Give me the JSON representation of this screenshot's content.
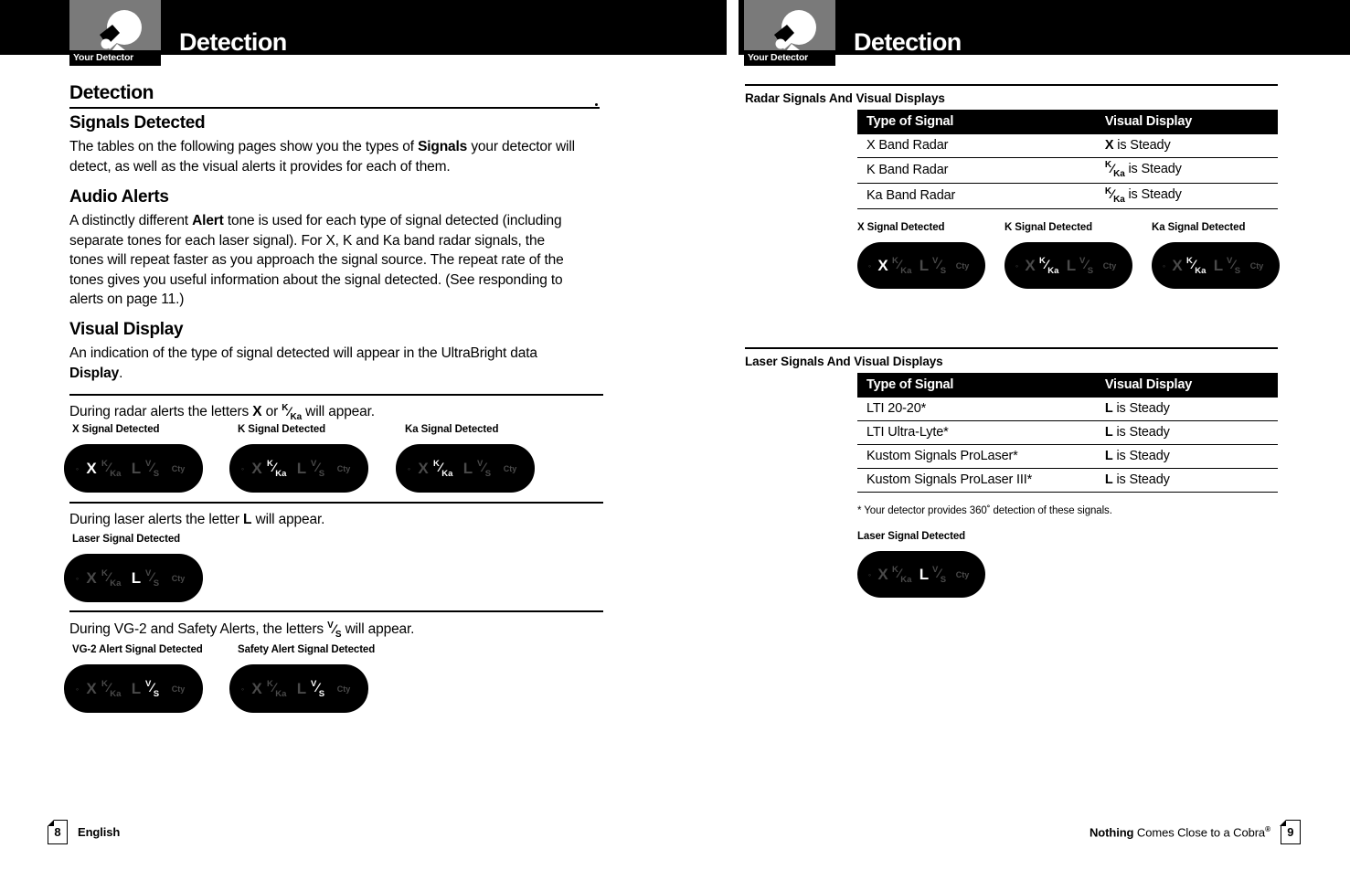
{
  "document": {
    "header_title": "Detection",
    "tab_label": "Your Detector",
    "tab_icon": "radar-detector-icon"
  },
  "left_page": {
    "section_title": "Detection",
    "signals_detected": {
      "heading": "Signals Detected",
      "paragraph_pre": "The tables on the following pages show you the types of ",
      "paragraph_bold": "Signals",
      "paragraph_post": " your detector will detect, as well as the visual alerts it provides for each of them."
    },
    "audio_alerts": {
      "heading": "Audio Alerts",
      "paragraph_pre": "A distinctly different ",
      "paragraph_bold": "Alert",
      "paragraph_post": " tone is used for each type of signal detected (including separate tones for each laser signal). For X, K and Ka band radar signals, the tones will repeat faster as you approach the signal source. The repeat rate of the tones gives you useful information about the signal detected. (See responding to alerts on page 11.)"
    },
    "visual_display": {
      "heading": "Visual Display",
      "paragraph_pre": "An indication of the type of signal detected will appear in the UltraBright data ",
      "paragraph_bold": "Display",
      "paragraph_post": "."
    },
    "radar_line": {
      "pre": "During radar alerts the letters ",
      "bold1": "X",
      "mid": " or ",
      "glyph": "K/Ka",
      "post": " will appear."
    },
    "laser_line": {
      "pre": "During laser alerts the letter ",
      "bold1": "L",
      "post": " will appear."
    },
    "vg2_line": {
      "pre": "During VG-2 and Safety Alerts, the letters ",
      "glyph": "V/S",
      "post": " will appear."
    },
    "radar_displays": [
      {
        "caption": "X Signal Detected",
        "active": "X"
      },
      {
        "caption": "K Signal Detected",
        "active": "KKa"
      },
      {
        "caption": "Ka Signal Detected",
        "active": "KKa"
      }
    ],
    "laser_displays": [
      {
        "caption": "Laser Signal Detected",
        "active": "L"
      }
    ],
    "vg2_displays": [
      {
        "caption": "VG-2 Alert Signal Detected",
        "active": "VS"
      },
      {
        "caption": "Safety Alert Signal Detected",
        "active": "VS"
      }
    ],
    "footer": {
      "page_number": "8",
      "label": "English"
    }
  },
  "right_page": {
    "radar_section": {
      "heading": "Radar Signals And Visual Displays",
      "columns": [
        "Type of Signal",
        "Visual Display"
      ],
      "rows": [
        {
          "signal": "X Band Radar",
          "display_symbol": "X",
          "display_text": " is Steady"
        },
        {
          "signal": "K Band Radar",
          "display_symbol": "K/Ka",
          "display_text": " is Steady"
        },
        {
          "signal": "Ka Band Radar",
          "display_symbol": "K/Ka",
          "display_text": " is Steady"
        }
      ],
      "displays": [
        {
          "caption": "X Signal Detected",
          "active": "X"
        },
        {
          "caption": "K Signal Detected",
          "active": "KKa"
        },
        {
          "caption": "Ka Signal Detected",
          "active": "KKa"
        }
      ]
    },
    "laser_section": {
      "heading": "Laser Signals And Visual Displays",
      "columns": [
        "Type of Signal",
        "Visual Display"
      ],
      "rows": [
        {
          "signal": "LTI 20-20*",
          "display_symbol": "L",
          "display_text": " is Steady"
        },
        {
          "signal": "LTI Ultra-Lyte*",
          "display_symbol": "L",
          "display_text": " is Steady"
        },
        {
          "signal": "Kustom Signals ProLaser*",
          "display_symbol": "L",
          "display_text": " is Steady"
        },
        {
          "signal": "Kustom Signals ProLaser III*",
          "display_symbol": "L",
          "display_text": " is Steady"
        }
      ],
      "note": "* Your detector provides 360˚ detection of these signals.",
      "displays": [
        {
          "caption": "Laser Signal Detected",
          "active": "L"
        }
      ]
    },
    "footer": {
      "page_number": "9",
      "tagline_bold": "Nothing",
      "tagline_rest": " Comes Close to a Cobra",
      "registered": "®"
    }
  },
  "display_segments": {
    "speaker": "speaker-icon",
    "x": "X",
    "k_num": "K",
    "k_slash": "/",
    "k_den": "Ka",
    "l": "L",
    "v_num": "V",
    "v_slash": "/",
    "v_den": "S",
    "cty": "Cty"
  },
  "colors": {
    "page_bg": "#ffffff",
    "header_bar": "#000000",
    "tab_gray": "#7a7a7a",
    "display_bg": "#000000",
    "segment_off": "#4a4a4a",
    "segment_on": "#ffffff"
  }
}
